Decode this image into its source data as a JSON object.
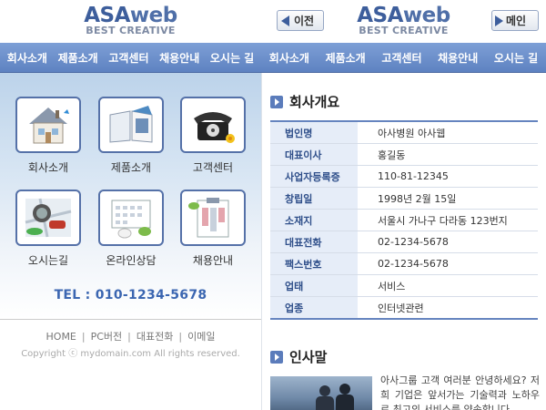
{
  "logo": {
    "main_a": "ASA",
    "main_b": "web",
    "sub": "BEST CREATIVE"
  },
  "nav": [
    "회사소개",
    "제품소개",
    "고객센터",
    "채용안내",
    "오시는 길"
  ],
  "home": {
    "tiles": [
      {
        "label": "회사소개",
        "icon": "house-icon"
      },
      {
        "label": "제품소개",
        "icon": "book-icon"
      },
      {
        "label": "고객센터",
        "icon": "telephone-icon"
      },
      {
        "label": "오시는길",
        "icon": "map-car-icon"
      },
      {
        "label": "온라인상담",
        "icon": "calendar-icon"
      },
      {
        "label": "채용안내",
        "icon": "clipboard-icon"
      }
    ],
    "tel": "TEL : 010-1234-5678",
    "footer": {
      "links": [
        "HOME",
        "PC버전",
        "대표전화",
        "이메일"
      ],
      "copyright": "Copyright ⓒ mydomain.com All rights reserved."
    }
  },
  "detail": {
    "prev_label": "이전",
    "main_label": "메인",
    "section_company": "회사개요",
    "rows": [
      {
        "k": "법인명",
        "v": "아사병원 아사웹"
      },
      {
        "k": "대표이사",
        "v": "홍길동"
      },
      {
        "k": "사업자등록증",
        "v": "110-81-12345"
      },
      {
        "k": "창립일",
        "v": "1998년 2월 15일"
      },
      {
        "k": "소재지",
        "v": "서울시 가나구 다라동 123번지"
      },
      {
        "k": "대표전화",
        "v": "02-1234-5678"
      },
      {
        "k": "팩스번호",
        "v": "02-1234-5678"
      },
      {
        "k": "업태",
        "v": "서비스"
      },
      {
        "k": "업종",
        "v": "인터넷관련"
      }
    ],
    "section_greeting": "인사말",
    "greeting": "아사그룹 고객 여러분 안녕하세요? 저희 기업은 앞서가는 기술력과 노하우로 최고의 서비스를 약속합니다."
  },
  "colors": {
    "accent": "#5e82c1",
    "tel": "#3b66b1",
    "table_key_bg": "#e6edf8"
  }
}
